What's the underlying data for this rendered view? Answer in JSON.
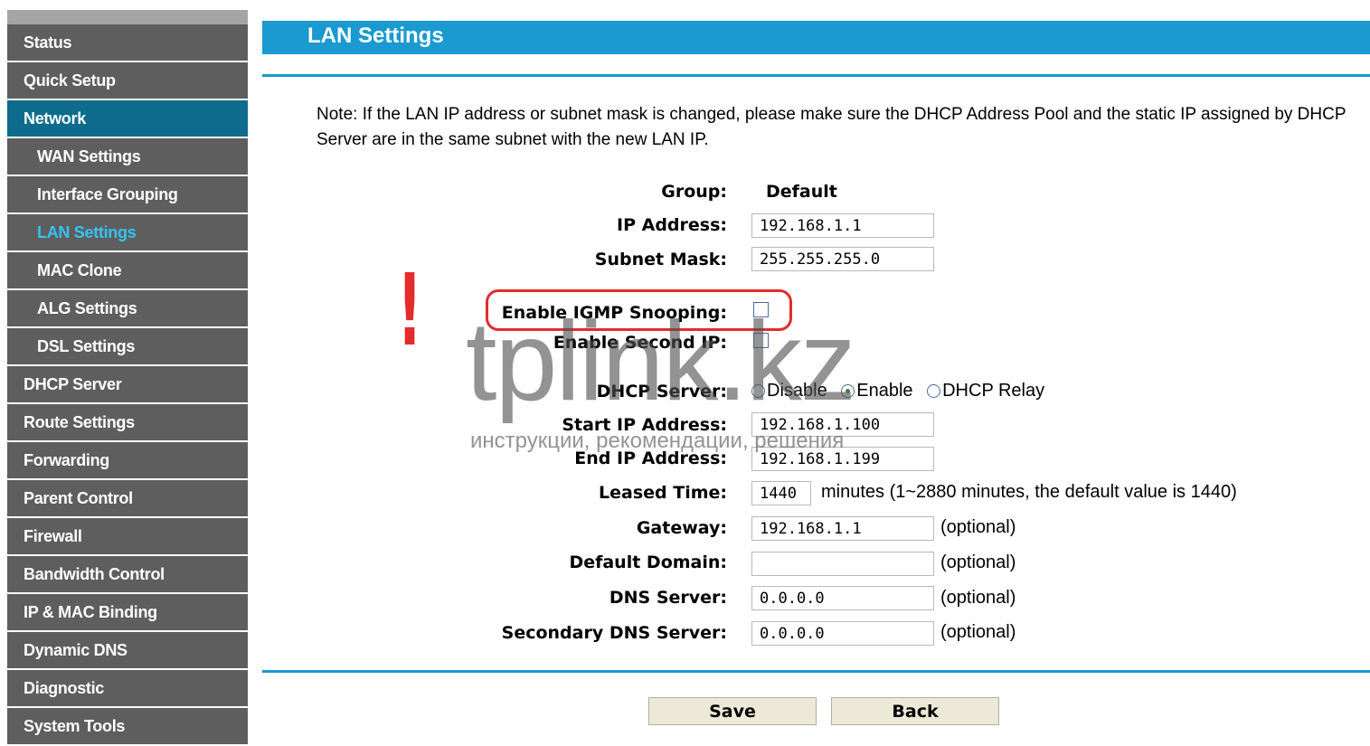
{
  "sidebar": {
    "items": [
      {
        "label": "Status"
      },
      {
        "label": "Quick Setup"
      },
      {
        "label": "Network"
      },
      {
        "label": "WAN Settings"
      },
      {
        "label": "Interface Grouping"
      },
      {
        "label": "LAN Settings"
      },
      {
        "label": "MAC Clone"
      },
      {
        "label": "ALG Settings"
      },
      {
        "label": "DSL Settings"
      },
      {
        "label": "DHCP Server"
      },
      {
        "label": "Route Settings"
      },
      {
        "label": "Forwarding"
      },
      {
        "label": "Parent Control"
      },
      {
        "label": "Firewall"
      },
      {
        "label": "Bandwidth Control"
      },
      {
        "label": "IP & MAC Binding"
      },
      {
        "label": "Dynamic DNS"
      },
      {
        "label": "Diagnostic"
      },
      {
        "label": "System Tools"
      }
    ]
  },
  "header": {
    "title": "LAN Settings"
  },
  "note": "Note: If the LAN IP address or subnet mask is changed, please make sure the DHCP Address Pool and the static IP assigned by DHCP Server are in the same subnet with the new LAN IP.",
  "form": {
    "group_label": "Group:",
    "group_value": "Default",
    "ip_label": "IP Address:",
    "ip_value": "192.168.1.1",
    "mask_label": "Subnet Mask:",
    "mask_value": "255.255.255.0",
    "igmp_label": "Enable IGMP Snooping:",
    "igmp_checked": false,
    "second_ip_label": "Enable Second IP:",
    "second_ip_checked": false,
    "dhcp_label": "DHCP Server:",
    "dhcp_options": [
      "Disable",
      "Enable",
      "DHCP Relay"
    ],
    "dhcp_selected": "Enable",
    "start_label": "Start IP Address:",
    "start_value": "192.168.1.100",
    "end_label": "End IP Address:",
    "end_value": "192.168.1.199",
    "lease_label": "Leased Time:",
    "lease_value": "1440",
    "lease_hint": "minutes (1~2880 minutes, the default value is 1440)",
    "gateway_label": "Gateway:",
    "gateway_value": "192.168.1.1",
    "domain_label": "Default Domain:",
    "domain_value": "",
    "dns_label": "DNS Server:",
    "dns_value": "0.0.0.0",
    "dns2_label": "Secondary DNS Server:",
    "dns2_value": "0.0.0.0",
    "optional": "(optional)"
  },
  "buttons": {
    "save": "Save",
    "back": "Back"
  },
  "annotation": {
    "mark": "!"
  },
  "watermark": {
    "main": "tplink.kz",
    "sub": "инструкции, рекомендации, решения"
  },
  "colors": {
    "header": "#1a9ad0",
    "sidebar": "#5e5e5e",
    "sidebar_active": "#0e6b8e",
    "sidebar_current_text": "#36c3f2",
    "highlight": "#e52b2b"
  }
}
